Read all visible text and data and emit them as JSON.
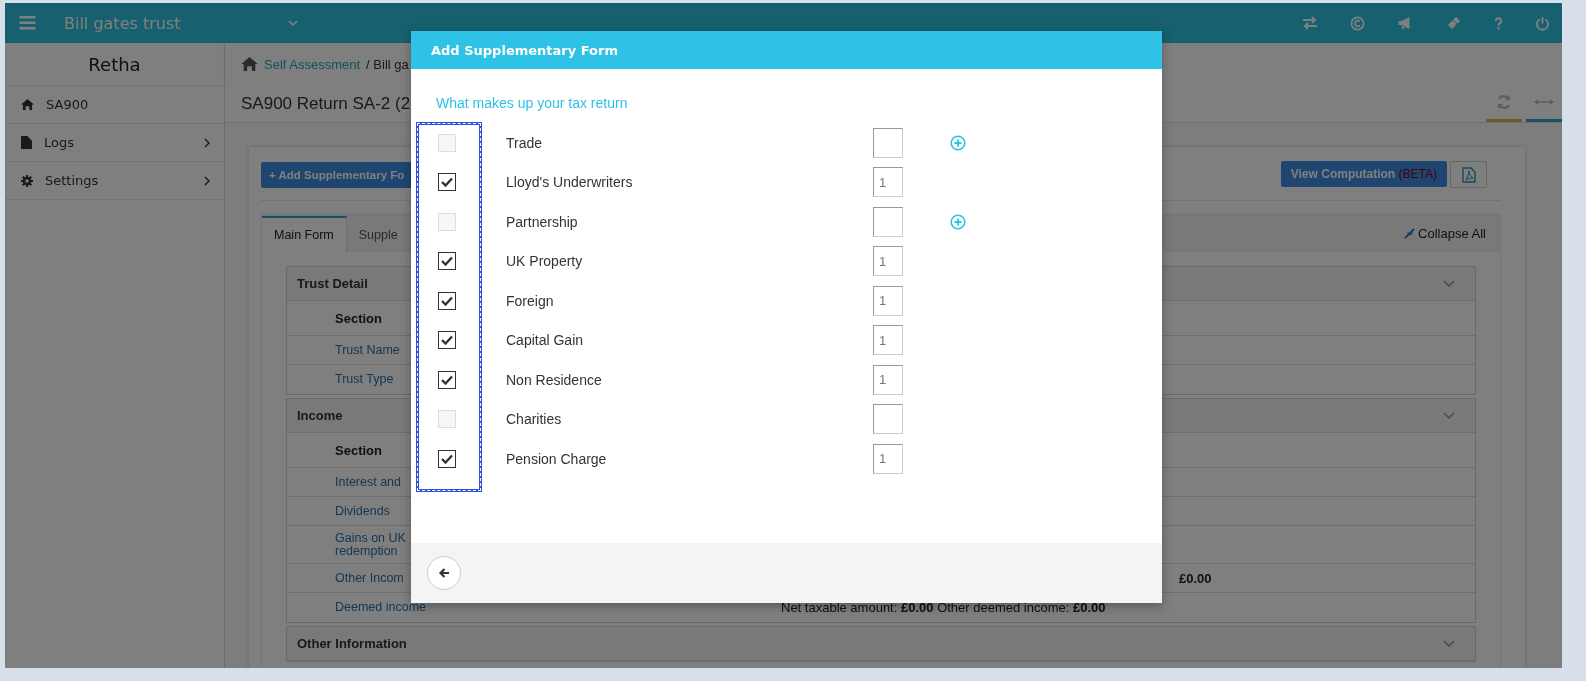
{
  "topbar": {
    "org_name": "Bill gates trust"
  },
  "sidebar": {
    "user": "Retha",
    "items": [
      {
        "label": "SA900",
        "kind": "home",
        "has_submenu": false
      },
      {
        "label": "Logs",
        "kind": "file",
        "has_submenu": true
      },
      {
        "label": "Settings",
        "kind": "gear",
        "has_submenu": true
      }
    ]
  },
  "breadcrumb": {
    "link": "Self Assessment",
    "rest": "/ Bill ga"
  },
  "page_title": "SA900 Return SA-2 (2",
  "toolbar": {
    "add_button": "+ Add Supplementary Fo",
    "view_button": "View Computation",
    "view_tag": "(BETA)"
  },
  "tabs": [
    {
      "label": "Main Form",
      "selected": true
    },
    {
      "label": "Supple",
      "selected": false
    }
  ],
  "collapse_all": "Collapse All",
  "sections": [
    {
      "title": "Trust Detail",
      "rows": [
        {
          "kind": "header",
          "label": "Section"
        },
        {
          "kind": "link",
          "label": "Trust Name"
        },
        {
          "kind": "link",
          "label": "Trust Type"
        }
      ]
    },
    {
      "title": "Income",
      "rows": [
        {
          "kind": "header",
          "label": "Section"
        },
        {
          "kind": "link",
          "label": "Interest and"
        },
        {
          "kind": "link",
          "label": "Dividends"
        },
        {
          "kind": "link",
          "label": "Gains on UK\nredemption"
        },
        {
          "kind": "link",
          "label": "Other Incom",
          "tail": "**£0.00**"
        },
        {
          "kind": "link",
          "label": "Deemed income",
          "value": "Net taxable amount: **£0.00** Other deemed income: **£0.00**"
        }
      ]
    },
    {
      "title": "Other Information"
    }
  ],
  "modal": {
    "title": "Add Supplementary Form",
    "subtitle": "What makes up your tax return",
    "forms": [
      {
        "label": "Trade",
        "checked": false,
        "add_icon": true
      },
      {
        "label": "Lloyd's Underwriters",
        "checked": true,
        "count": "1",
        "add_icon": false
      },
      {
        "label": "Partnership",
        "checked": false,
        "add_icon": true
      },
      {
        "label": "UK Property",
        "checked": true,
        "count": "1",
        "add_icon": false
      },
      {
        "label": "Foreign",
        "checked": true,
        "count": "1",
        "add_icon": false
      },
      {
        "label": "Capital Gain",
        "checked": true,
        "count": "1",
        "add_icon": false
      },
      {
        "label": "Non Residence",
        "checked": true,
        "count": "1",
        "add_icon": false
      },
      {
        "label": "Charities",
        "checked": false,
        "add_icon": false
      },
      {
        "label": "Pension Charge",
        "checked": true,
        "count": "1",
        "add_icon": false
      }
    ]
  }
}
